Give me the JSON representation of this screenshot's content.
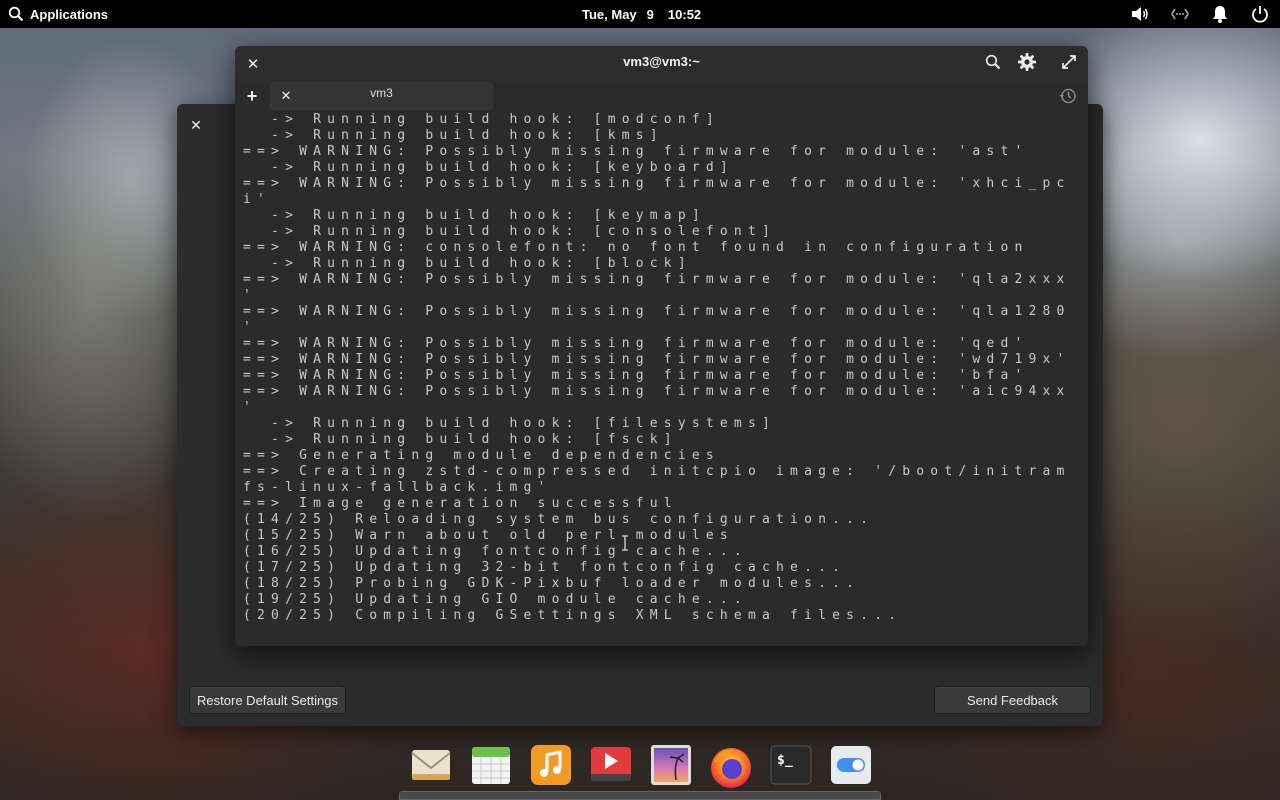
{
  "top_panel": {
    "applications_label": "Applications",
    "date": "Tue, May",
    "day": "9",
    "time": "10:52"
  },
  "background_window": {
    "restore_label": "Restore Default Settings",
    "feedback_label": "Send Feedback"
  },
  "terminal": {
    "title": "vm3@vm3:~",
    "tab_label": "vm3",
    "lines": [
      "  -> Running build hook: [modconf]",
      "  -> Running build hook: [kms]",
      "==> WARNING: Possibly missing firmware for module: 'ast'",
      "  -> Running build hook: [keyboard]",
      "==> WARNING: Possibly missing firmware for module: 'xhci_pc",
      "i'",
      "  -> Running build hook: [keymap]",
      "  -> Running build hook: [consolefont]",
      "==> WARNING: consolefont: no font found in configuration",
      "  -> Running build hook: [block]",
      "==> WARNING: Possibly missing firmware for module: 'qla2xxx",
      "'",
      "==> WARNING: Possibly missing firmware for module: 'qla1280",
      "'",
      "==> WARNING: Possibly missing firmware for module: 'qed'",
      "==> WARNING: Possibly missing firmware for module: 'wd719x'",
      "==> WARNING: Possibly missing firmware for module: 'bfa'",
      "==> WARNING: Possibly missing firmware for module: 'aic94xx",
      "'",
      "  -> Running build hook: [filesystems]",
      "  -> Running build hook: [fsck]",
      "==> Generating module dependencies",
      "==> Creating zstd-compressed initcpio image: '/boot/initram",
      "fs-linux-fallback.img'",
      "==> Image generation successful",
      "(14/25) Reloading system bus configuration...",
      "(15/25) Warn about old perl modules",
      "(16/25) Updating fontconfig cache...",
      "(17/25) Updating 32-bit fontconfig cache...",
      "(18/25) Probing GDK-Pixbuf loader modules...",
      "(19/25) Updating GIO module cache...",
      "(20/25) Compiling GSettings XML schema files..."
    ]
  },
  "dock": {
    "items": [
      "mail-icon",
      "calendar-icon",
      "music-icon",
      "videos-icon",
      "photos-icon",
      "firefox-icon",
      "terminal-icon",
      "settings-icon"
    ]
  },
  "colors": {
    "panel_bg": "#000000",
    "terminal_bg": "#2b2b2b",
    "terminal_text": "#c8c8c8"
  }
}
